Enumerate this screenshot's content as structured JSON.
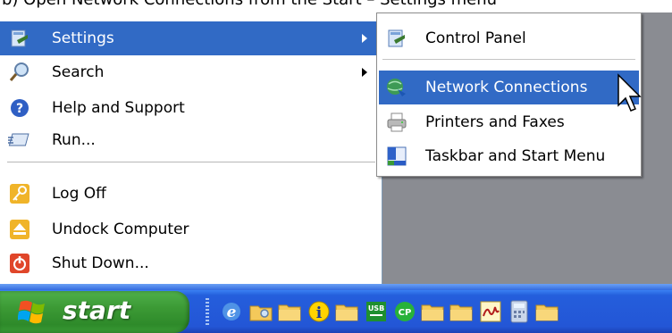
{
  "caption": "b) Open Network Connections from the Start – Settings menu",
  "start_menu": {
    "items": [
      {
        "label": "Settings",
        "icon": "settings-icon",
        "has_submenu": true,
        "active": true
      },
      {
        "label": "Search",
        "icon": "search-icon",
        "has_submenu": true
      },
      {
        "label": "Help and Support",
        "icon": "help-icon"
      },
      {
        "label": "Run...",
        "icon": "run-icon"
      },
      {
        "label": "Log Off",
        "icon": "key-icon"
      },
      {
        "label": "Undock Computer",
        "icon": "eject-icon"
      },
      {
        "label": "Shut Down...",
        "icon": "power-icon"
      }
    ]
  },
  "submenu": {
    "items": [
      {
        "label": "Control Panel",
        "icon": "control-panel-icon"
      },
      {
        "label": "Network Connections",
        "icon": "network-icon",
        "active": true
      },
      {
        "label": "Printers and Faxes",
        "icon": "printer-icon"
      },
      {
        "label": "Taskbar and Start Menu",
        "icon": "taskbar-icon"
      }
    ]
  },
  "taskbar": {
    "start_label": "start",
    "quick_launch": [
      "ie-icon",
      "folder-search-icon",
      "folder-icon",
      "info-icon",
      "folder-icon",
      "usb-icon",
      "cp-icon",
      "folder-icon",
      "signature-icon",
      "calculator-icon",
      "folder-icon"
    ],
    "usb_text": "USB",
    "cp_text": "CP"
  },
  "colors": {
    "highlight": "#316ac5",
    "taskbar": "#245edc",
    "start_button": "#3c9a35",
    "desktop": "#8a8c92"
  }
}
